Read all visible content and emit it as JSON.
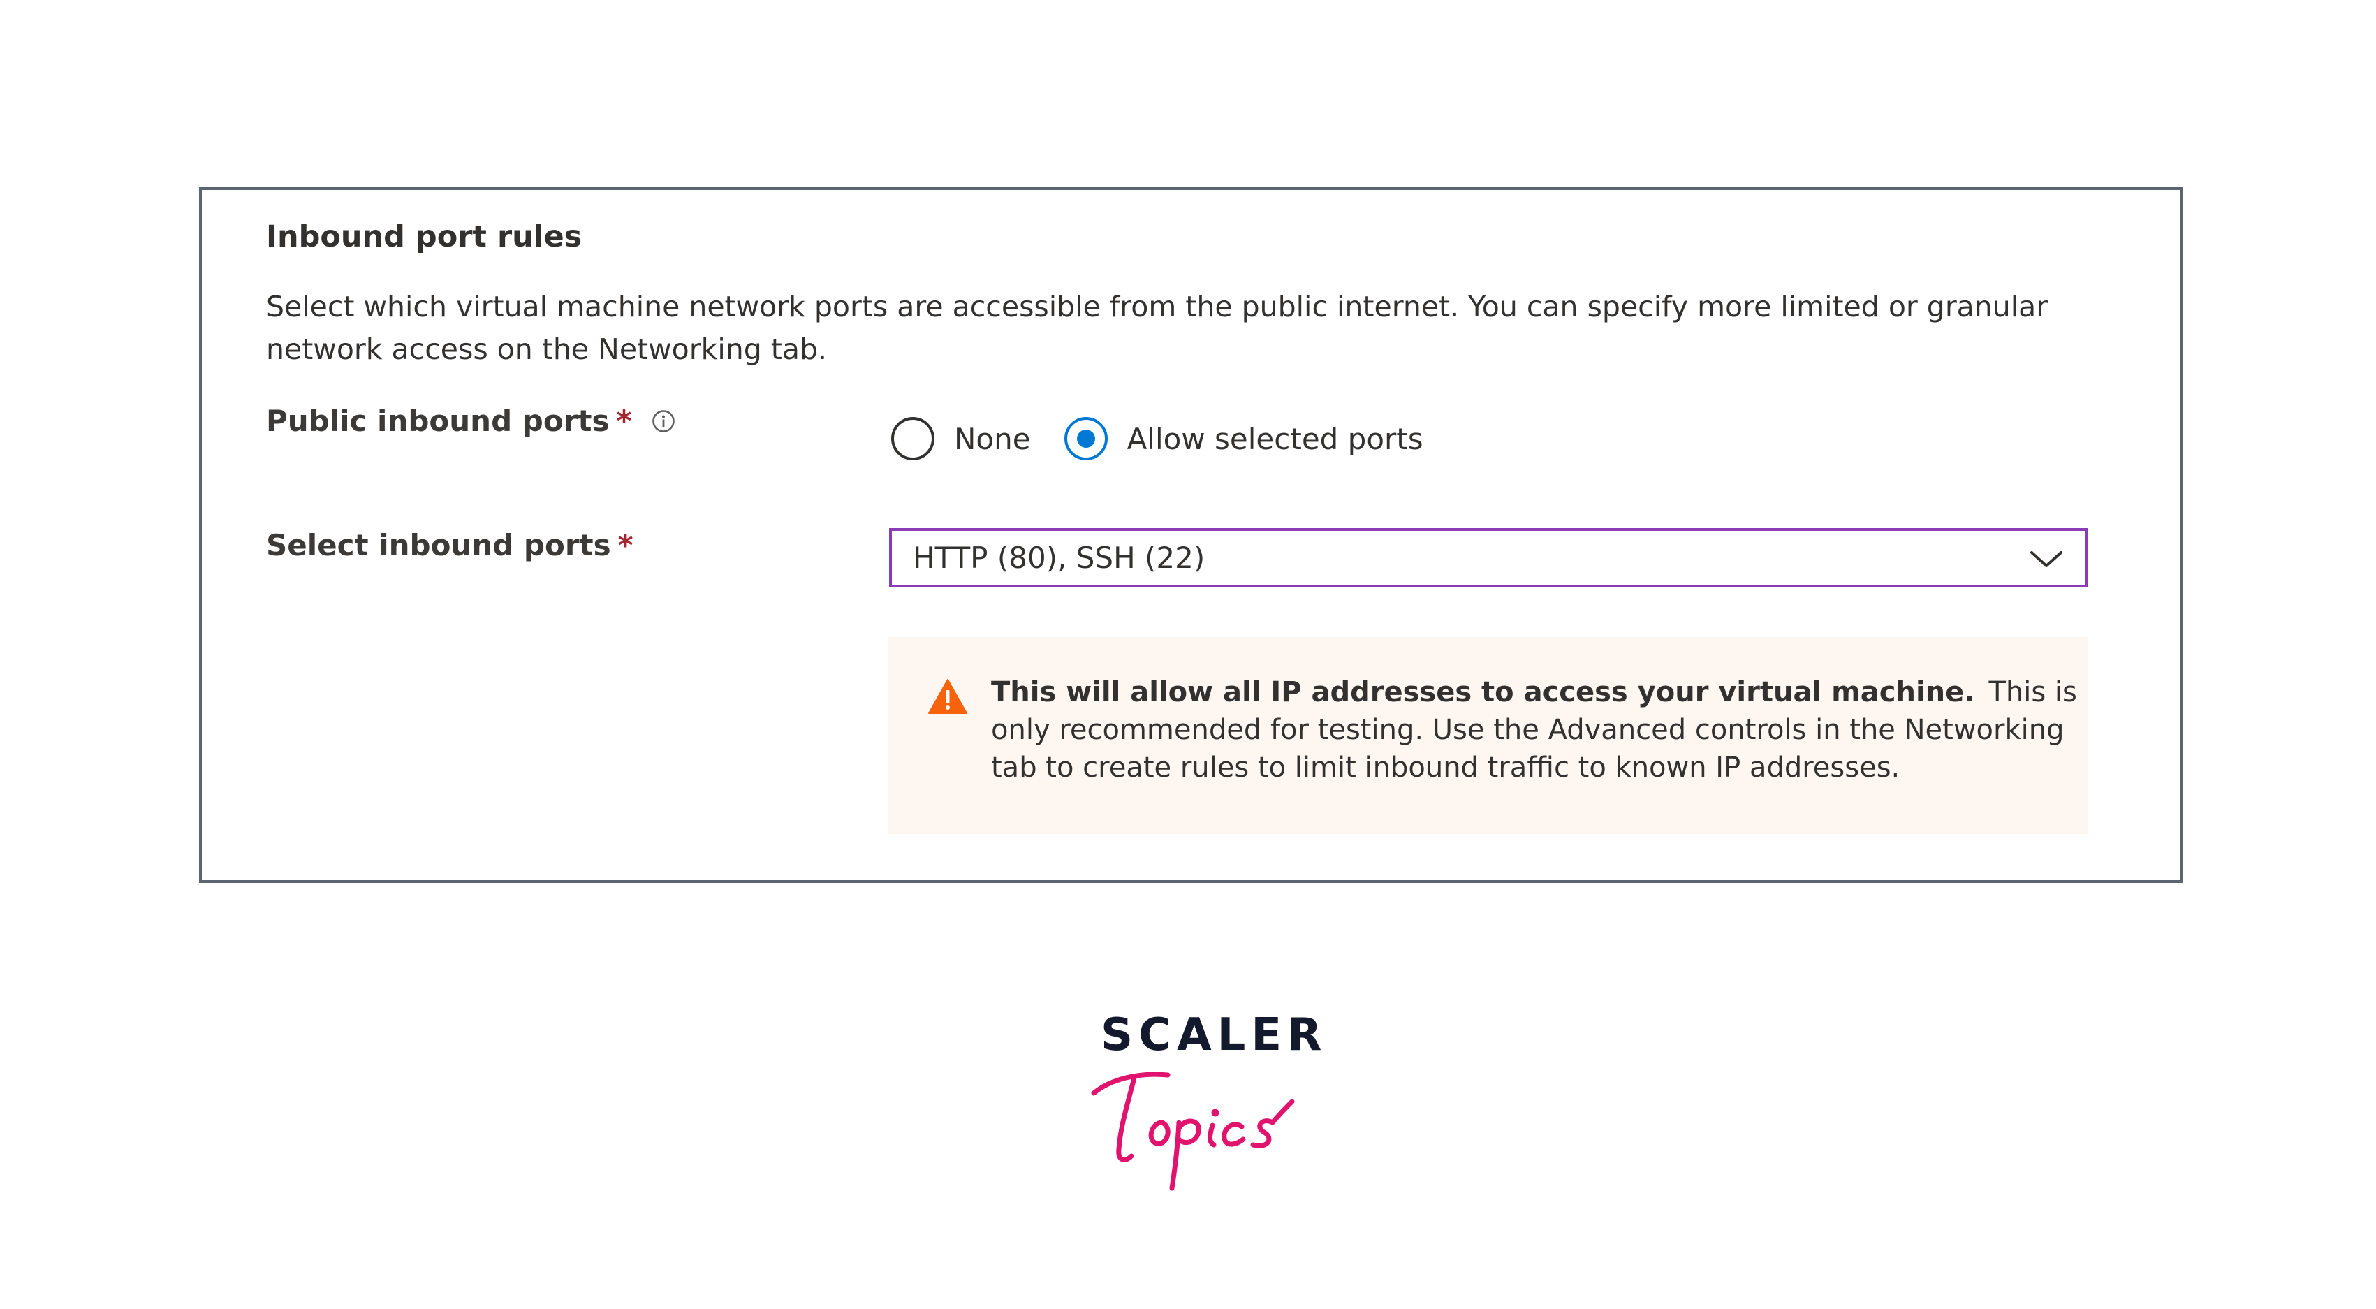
{
  "section": {
    "title": "Inbound port rules",
    "description": "Select which virtual machine network ports are accessible from the public internet. You can specify more limited or granular network access on the Networking tab."
  },
  "public_inbound_ports": {
    "label": "Public inbound ports",
    "required_marker": "*",
    "info_icon": "info-circle-icon",
    "options": [
      {
        "label": "None",
        "selected": false
      },
      {
        "label": "Allow selected ports",
        "selected": true
      }
    ]
  },
  "select_inbound_ports": {
    "label": "Select inbound ports",
    "required_marker": "*",
    "value": "HTTP (80), SSH (22)",
    "chevron_icon": "chevron-down-icon"
  },
  "warning": {
    "icon": "warning-triangle-icon",
    "bold_text": "This will allow all IP addresses to access your virtual machine.",
    "body_text": "This is only recommended for testing.  Use the Advanced controls in the Networking tab to create rules to limit inbound traffic to known IP addresses."
  },
  "logo": {
    "line1": "SCALER",
    "line2": "Topics"
  },
  "colors": {
    "accent_blue": "#0078d4",
    "required_red": "#a4262c",
    "dropdown_border": "#8a3bb6",
    "warning_orange": "#f7630c",
    "warning_bg": "#fdf6f1",
    "panel_border": "#5b6470",
    "logo_dark": "#141a2e",
    "logo_pink": "#e0146e"
  }
}
